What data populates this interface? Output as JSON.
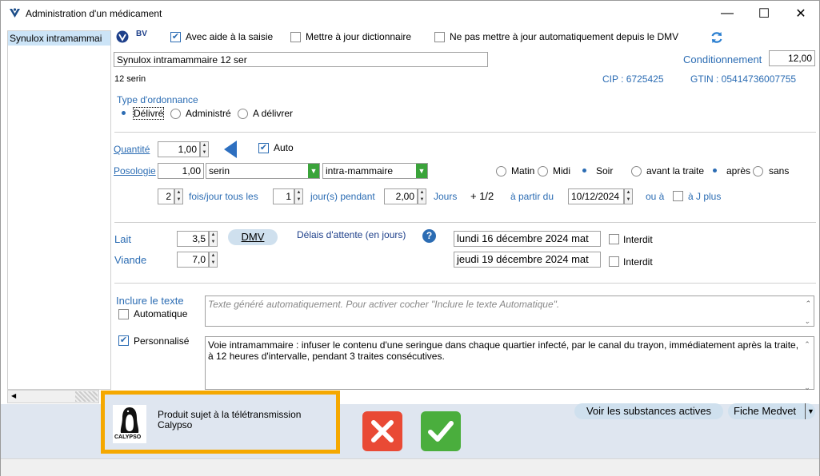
{
  "window": {
    "title": "Administration d'un médicament",
    "minimize": "—",
    "maximize": "☐",
    "close": "✕"
  },
  "sidebar": {
    "items": [
      {
        "label": "Synulox intramammai"
      }
    ]
  },
  "header": {
    "bv_label": "BV",
    "avec_aide_label": "Avec aide à la saisie",
    "avec_aide_checked": true,
    "maj_dict_label": "Mettre à jour dictionnaire",
    "ne_pas_maj_label": "Ne pas mettre à jour automatiquement depuis le DMV",
    "product_name": "Synulox intramammaire 12 ser",
    "product_sub": "12 serin",
    "conditionnement_label": "Conditionnement",
    "conditionnement_value": "12,00",
    "cip": "CIP : 6725425",
    "gtin": "GTIN : 05414736007755"
  },
  "ordonnance": {
    "title": "Type d'ordonnance",
    "options": [
      "Délivré",
      "Administré",
      "A délivrer"
    ],
    "selected": "Délivré"
  },
  "posologie": {
    "quantite_label": "Quantité",
    "quantite_value": "1,00",
    "auto_label": "Auto",
    "auto_checked": true,
    "posologie_label": "Posologie",
    "posologie_value": "1,00",
    "unit": "serin",
    "route": "intra-mammaire",
    "moments": [
      "Matin",
      "Midi",
      "Soir",
      "avant la traite",
      "après",
      "sans"
    ],
    "moment_selected": [
      "Soir",
      "après"
    ],
    "fois_value": "2",
    "fois_label": "fois/jour tous les",
    "jours_value": "1",
    "jours_label": "jour(s) pendant",
    "duree_value": "2,00",
    "duree_unit": "Jours",
    "plus_half": "+ 1/2",
    "a_partir_label": "à partir du",
    "date_value": "10/12/2024",
    "ou_a_label": "ou à",
    "a_j_plus_label": "à J plus"
  },
  "attente": {
    "lait_label": "Lait",
    "lait_value": "3,5",
    "viande_label": "Viande",
    "viande_value": "7,0",
    "dmv_button": "DMV",
    "delais_label": "Délais d'attente (en jours)",
    "help_icon": "?",
    "lait_date": "lundi 16 décembre 2024 mat",
    "viande_date": "jeudi 19 décembre 2024 mat",
    "interdit_label": "Interdit"
  },
  "texte": {
    "inclure_label": "Inclure le texte",
    "automatique_label": "Automatique",
    "automatique_checked": false,
    "auto_placeholder": "Texte généré automatiquement. Pour activer cocher \"Inclure le texte Automatique\".",
    "personnalise_label": "Personnalisé",
    "personnalise_checked": true,
    "personnalise_text": "Voie intramammaire : infuser le contenu d'une seringue dans chaque quartier infecté, par le canal du trayon, immédiatement après la traite, à 12 heures d'intervalle, pendant 3 traites consécutives."
  },
  "footer": {
    "teletransmission_text": "Produit sujet à la télétransmission Calypso",
    "calypso_logo": "CALYPSO",
    "substances_button": "Voir les substances actives",
    "fiche_button": "Fiche Medvet",
    "highlight_color": "#f5a800"
  }
}
